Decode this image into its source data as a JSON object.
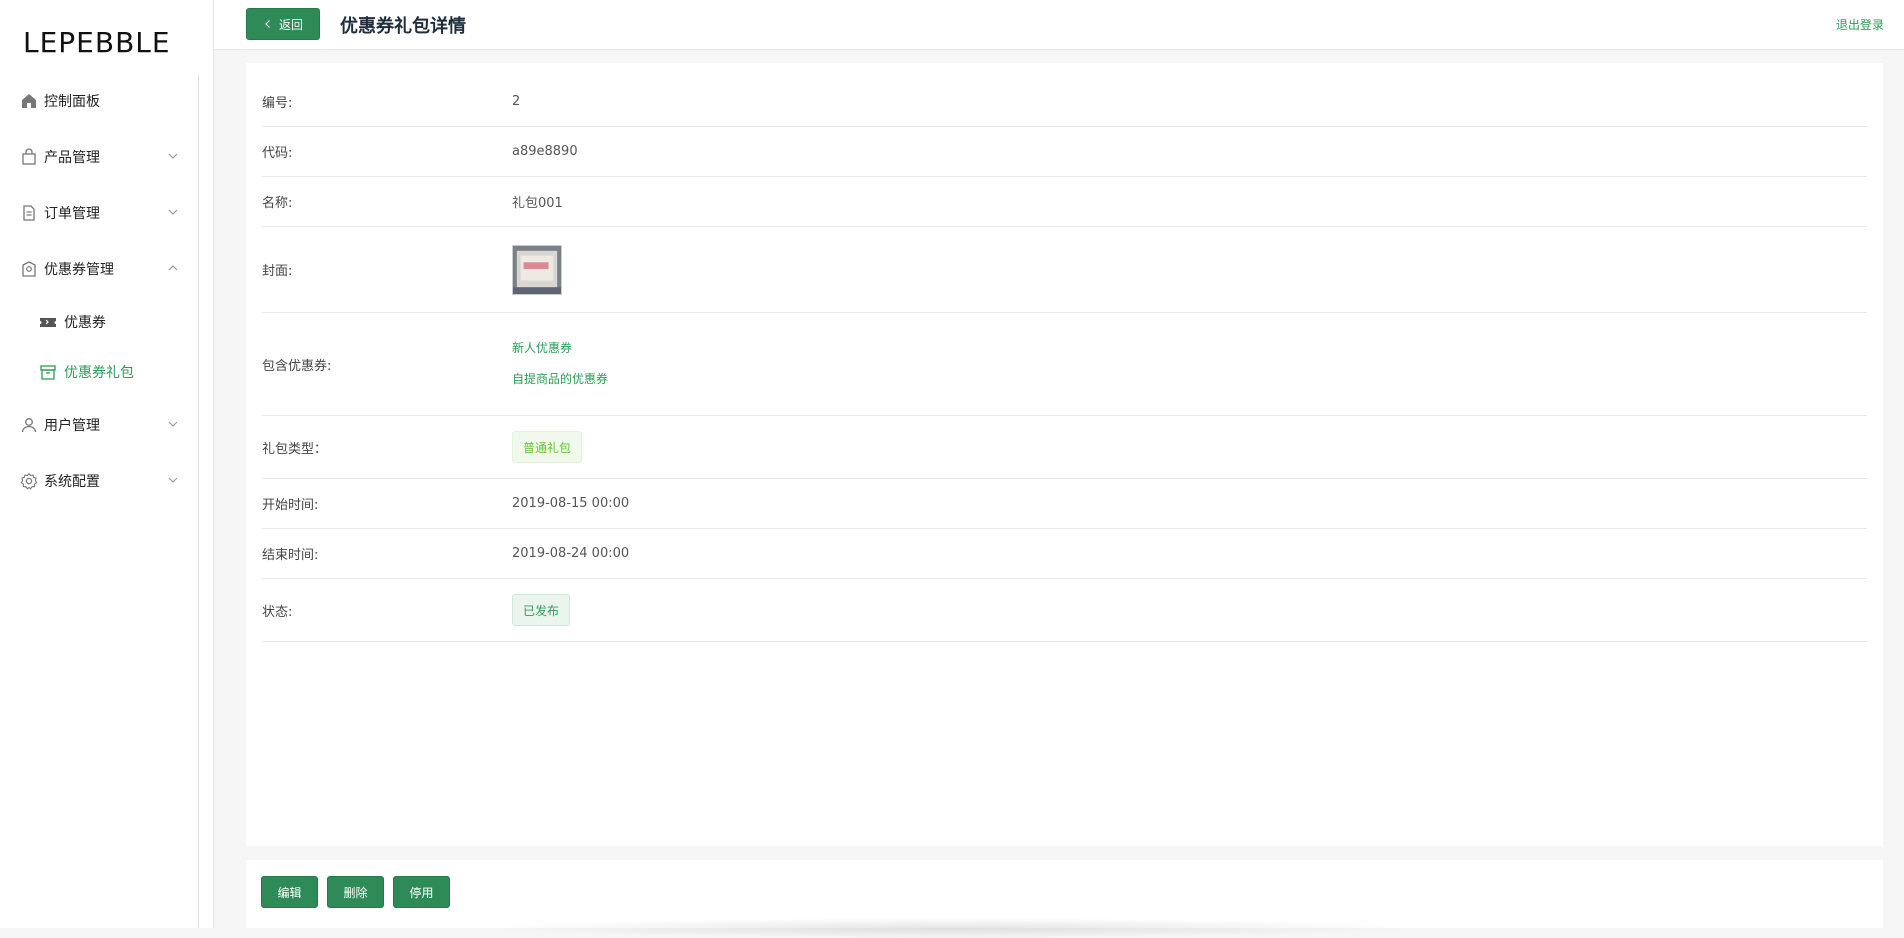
{
  "app": {
    "logo": "LEPEBBLE",
    "accent": "#2e9c57"
  },
  "sidebar": {
    "items": [
      {
        "label": "控制面板",
        "icon": "home-icon"
      },
      {
        "label": "产品管理",
        "icon": "bag-icon"
      },
      {
        "label": "订单管理",
        "icon": "document-icon"
      },
      {
        "label": "优惠券管理",
        "icon": "coupon-shield-icon"
      },
      {
        "label": "优惠券",
        "icon": "ticket-icon"
      },
      {
        "label": "优惠券礼包",
        "icon": "box-icon"
      },
      {
        "label": "用户管理",
        "icon": "user-icon"
      },
      {
        "label": "系统配置",
        "icon": "gear-icon"
      }
    ]
  },
  "header": {
    "back_label": "返回",
    "title": "优惠券礼包详情",
    "logout_label": "退出登录"
  },
  "detail": {
    "id_label": "编号:",
    "id_value": "2",
    "code_label": "代码:",
    "code_value": "a89e8890",
    "name_label": "名称:",
    "name_value": "礼包001",
    "cover_label": "封面:",
    "coupons_label": "包含优惠券:",
    "coupons": [
      "新人优惠券",
      "自提商品的优惠券"
    ],
    "type_label": "礼包类型：",
    "type_value": "普通礼包",
    "start_label": "开始时间:",
    "start_value": "2019-08-15 00:00",
    "end_label": "结束时间:",
    "end_value": "2019-08-24 00:00",
    "status_label": "状态:",
    "status_value": "已发布"
  },
  "footer": {
    "edit_label": "编辑",
    "delete_label": "删除",
    "disable_label": "停用"
  }
}
